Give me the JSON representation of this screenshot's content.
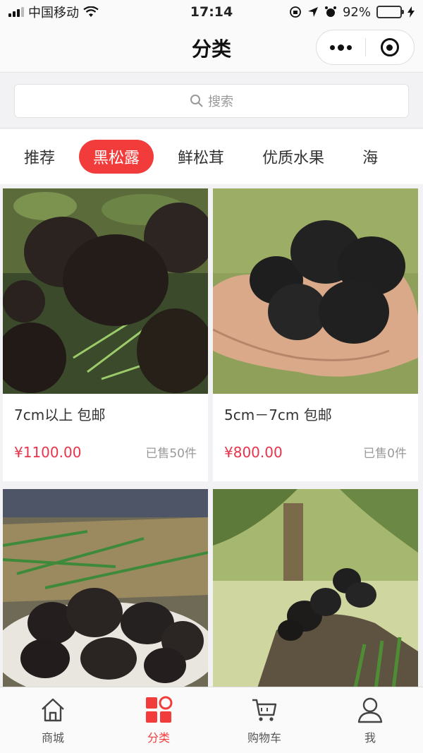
{
  "status_bar": {
    "carrier": "中国移动",
    "time": "17:14",
    "battery": "92%",
    "battery_level": 0.92
  },
  "nav": {
    "title": "分类"
  },
  "search": {
    "placeholder": "搜索"
  },
  "tabs": [
    {
      "label": "推荐",
      "active": false
    },
    {
      "label": "黑松露",
      "active": true
    },
    {
      "label": "鲜松茸",
      "active": false
    },
    {
      "label": "优质水果",
      "active": false
    },
    {
      "label": "海",
      "active": false
    }
  ],
  "products": [
    {
      "name": "7cm以上 包邮",
      "price": "¥1100.00",
      "sold": "已售50件"
    },
    {
      "name": "5cm－7cm 包邮",
      "price": "¥800.00",
      "sold": "已售0件"
    },
    {
      "name": "",
      "price": "",
      "sold": ""
    },
    {
      "name": "",
      "price": "",
      "sold": ""
    }
  ],
  "tab_bar": [
    {
      "label": "商城",
      "icon": "home-icon",
      "active": false
    },
    {
      "label": "分类",
      "icon": "category-icon",
      "active": true
    },
    {
      "label": "购物车",
      "icon": "cart-icon",
      "active": false
    },
    {
      "label": "我",
      "icon": "user-icon",
      "active": false
    }
  ],
  "colors": {
    "accent": "#f23c3c",
    "price": "#e8344b"
  }
}
